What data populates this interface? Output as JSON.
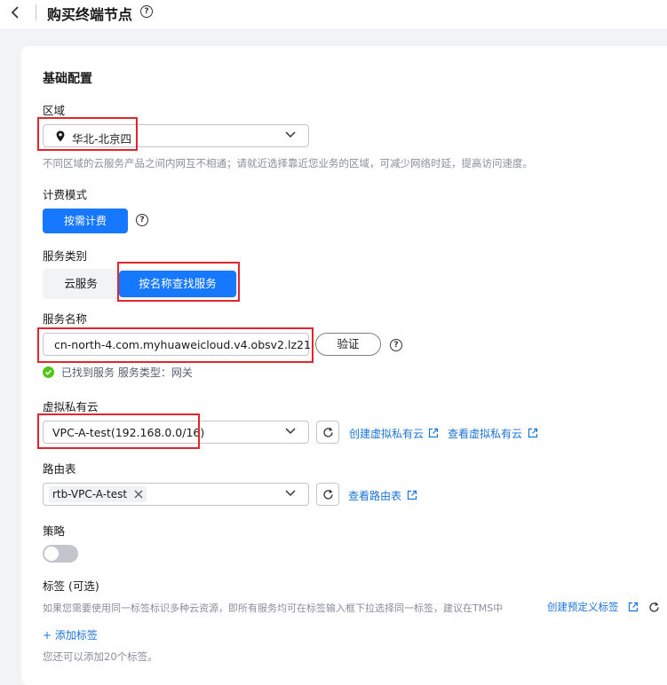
{
  "header": {
    "title": "购买终端节点"
  },
  "form": {
    "section_title": "基础配置",
    "region": {
      "label": "区域",
      "value": "华北-北京四",
      "hint": "不同区域的云服务产品之间内网互不相通；请就近选择靠近您业务的区域，可减少网络时延，提高访问速度。"
    },
    "billing": {
      "label": "计费模式",
      "option": "按需计费"
    },
    "service_type": {
      "label": "服务类别",
      "options": [
        "云服务",
        "按名称查找服务"
      ],
      "selected": "按名称查找服务"
    },
    "service_name": {
      "label": "服务名称",
      "value": "cn-north-4.com.myhuaweicloud.v4.obsv2.lz21",
      "verify_label": "验证",
      "status": "已找到服务 服务类型：网关"
    },
    "vpc": {
      "label": "虚拟私有云",
      "value": "VPC-A-test(192.168.0.0/16)",
      "create_link": "创建虚拟私有云",
      "view_link": "查看虚拟私有云"
    },
    "route_table": {
      "label": "路由表",
      "tag": "rtb-VPC-A-test",
      "view_link": "查看路由表"
    },
    "policy": {
      "label": "策略",
      "enabled": false
    },
    "tags": {
      "label": "标签 (可选)",
      "hint": "如果您需要使用同一标签标识多种云资源，即所有服务均可在标签输入框下拉选择同一标签，建议在TMS中",
      "create_link": "创建预定义标签",
      "add_label": "+ 添加标签",
      "remaining": "您还可以添加20个标签。"
    }
  },
  "colors": {
    "primary": "#1677ff",
    "highlight": "#e0262f",
    "success": "#52c41a",
    "link": "#1a73d9"
  }
}
